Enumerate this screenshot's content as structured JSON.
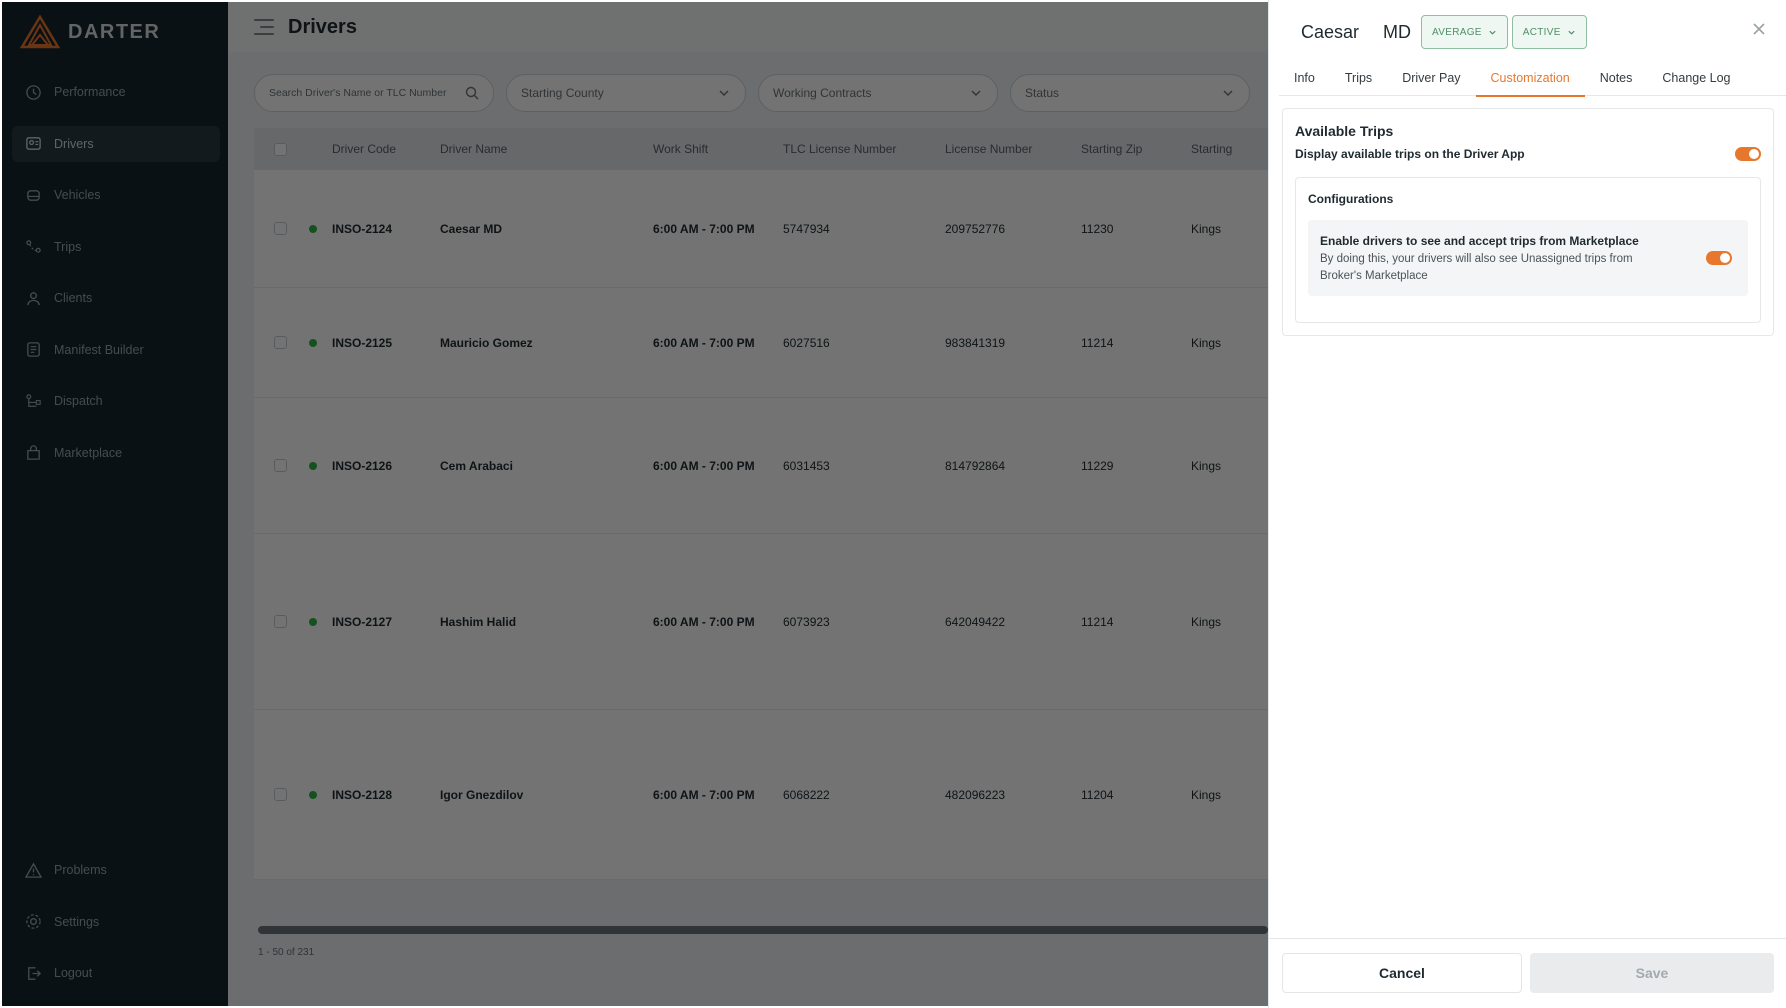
{
  "brand": {
    "name": "DARTER"
  },
  "sidebar": {
    "top": [
      {
        "label": "Performance",
        "icon": "performance-icon"
      },
      {
        "label": "Drivers",
        "icon": "drivers-icon",
        "active": true
      },
      {
        "label": "Vehicles",
        "icon": "vehicles-icon"
      },
      {
        "label": "Trips",
        "icon": "trips-icon"
      },
      {
        "label": "Clients",
        "icon": "clients-icon"
      },
      {
        "label": "Manifest Builder",
        "icon": "manifest-icon"
      },
      {
        "label": "Dispatch",
        "icon": "dispatch-icon"
      },
      {
        "label": "Marketplace",
        "icon": "marketplace-icon"
      }
    ],
    "bottom": [
      {
        "label": "Problems",
        "icon": "warning-icon"
      },
      {
        "label": "Settings",
        "icon": "gear-icon"
      },
      {
        "label": "Logout",
        "icon": "logout-icon"
      }
    ]
  },
  "page": {
    "title": "Drivers"
  },
  "filters": {
    "search_placeholder": "Search Driver's Name or TLC Number",
    "starting_county": "Starting County",
    "working_contracts": "Working Contracts",
    "status": "Status"
  },
  "table": {
    "columns": [
      "Driver Code",
      "Driver Name",
      "Work Shift",
      "TLC License Number",
      "License Number",
      "Starting Zip",
      "Starting"
    ],
    "rows": [
      {
        "code": "INSO-2124",
        "name": "Caesar MD",
        "shift": "6:00 AM - 7:00 PM",
        "tlc": "5747934",
        "license": "209752776",
        "zip": "11230",
        "county": "Kings"
      },
      {
        "code": "INSO-2125",
        "name": "Mauricio Gomez",
        "shift": "6:00 AM - 7:00 PM",
        "tlc": "6027516",
        "license": "983841319",
        "zip": "11214",
        "county": "Kings"
      },
      {
        "code": "INSO-2126",
        "name": "Cem Arabaci",
        "shift": "6:00 AM - 7:00 PM",
        "tlc": "6031453",
        "license": "814792864",
        "zip": "11229",
        "county": "Kings"
      },
      {
        "code": "INSO-2127",
        "name": "Hashim Halid",
        "shift": "6:00 AM - 7:00 PM",
        "tlc": "6073923",
        "license": "642049422",
        "zip": "11214",
        "county": "Kings"
      },
      {
        "code": "INSO-2128",
        "name": "Igor Gnezdilov",
        "shift": "6:00 AM - 7:00 PM",
        "tlc": "6068222",
        "license": "482096223",
        "zip": "11204",
        "county": "Kings"
      }
    ],
    "pager": "1 - 50 of 231"
  },
  "drawer": {
    "first_name": "Caesar",
    "last_name": "MD",
    "rating_badge": "AVERAGE",
    "status_badge": "ACTIVE",
    "tabs": [
      "Info",
      "Trips",
      "Driver Pay",
      "Customization",
      "Notes",
      "Change Log"
    ],
    "active_tab": "Customization",
    "section_title": "Available Trips",
    "display_toggle_label": "Display available trips on the Driver App",
    "configurations_title": "Configurations",
    "option_title": "Enable drivers to see and accept trips from Marketplace",
    "option_desc": "By doing this, your drivers will also see Unassigned trips from Broker's Marketplace",
    "cancel_label": "Cancel",
    "save_label": "Save"
  },
  "colors": {
    "accent": "#e8772e",
    "sidebar": "#16262d",
    "status_active": "#2fb344"
  }
}
